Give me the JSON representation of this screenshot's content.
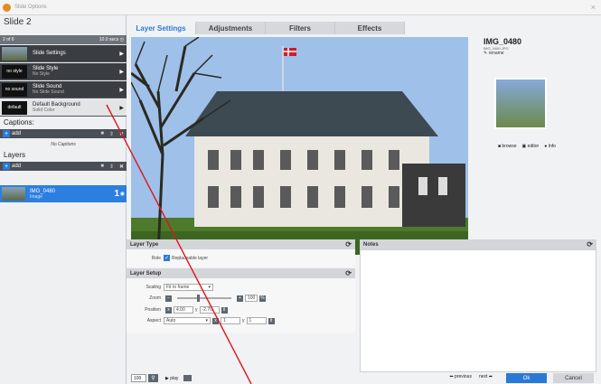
{
  "window": {
    "title": "Slide Options",
    "close": "×"
  },
  "left": {
    "slide_title": "Slide 2",
    "slide_count": "2 of 6",
    "duration": "10.0 secs",
    "slide_rows": [
      {
        "thumb": "",
        "label": "Slide Settings",
        "sub": ""
      },
      {
        "thumb": "no style",
        "label": "Slide Style",
        "sub": "No Style"
      },
      {
        "thumb": "no sound",
        "label": "Slide Sound",
        "sub": "No Slide Sound"
      },
      {
        "thumb": "default",
        "label": "Default Background",
        "sub": "Solid Color"
      }
    ],
    "captions_label": "Captions:",
    "captions_add": "add",
    "no_captions": "No Captions",
    "layers_label": "Layers",
    "layers_add": "add",
    "layer": {
      "name": "IMG_0480",
      "type": "Image",
      "num": "1"
    }
  },
  "tabs": [
    "Layer Settings",
    "Adjustments",
    "Filters",
    "Effects"
  ],
  "info": {
    "name": "IMG_0480",
    "file": "IMG_0480.JPG",
    "rename": "rename",
    "browse": "browse",
    "editor": "editor",
    "info": "Info"
  },
  "layer_type": {
    "header": "Layer Type",
    "role_label": "Role",
    "role_value": "Replaceable layer"
  },
  "notes": {
    "header": "Notes"
  },
  "layer_setup": {
    "header": "Layer Setup",
    "scaling_label": "Scaling",
    "scaling_value": "Fit to frame",
    "zoom_label": "Zoom",
    "zoom_value": "100",
    "position_label": "Position",
    "pos_x": "4.00",
    "pos_y": "-2.70",
    "aspect_label": "Aspect",
    "aspect_value": "Auto",
    "aspect_x": "1",
    "aspect_y": "1"
  },
  "bottom": {
    "zoom": "100",
    "play": "play",
    "previous": "previous",
    "next": "next",
    "ok": "Ok",
    "cancel": "Cancel"
  }
}
